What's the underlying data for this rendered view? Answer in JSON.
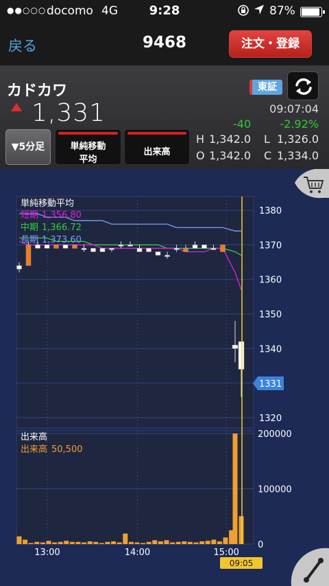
{
  "status": {
    "signal": "●●○○○",
    "carrier": "docomo",
    "network": "4G",
    "time": "9:28",
    "battery": "87%"
  },
  "nav": {
    "back": "戻る",
    "title": "9468",
    "order_button": "注文・登録"
  },
  "quote": {
    "name": "カドカワ",
    "exchange": "東証",
    "price": "1,331",
    "time": "09:07:04",
    "change": "-40",
    "change_pct": "-2.92%",
    "high_label": "H",
    "high": "1,342.0",
    "low_label": "L",
    "low": "1,326.0",
    "open_label": "O",
    "open": "1,342.0",
    "close_label": "C",
    "close": "1,334.0"
  },
  "buttons": {
    "period": "▼5分足",
    "ma_line1": "単純移動",
    "ma_line2": "平均",
    "volume": "出来高"
  },
  "colors": {
    "up": "#e52b2b",
    "down": "#35c738",
    "short_ma": "#e020e0",
    "mid_ma": "#30d040",
    "long_ma": "#7a9fff",
    "volume": "#f0a030",
    "bg": "#1d2a55"
  },
  "chart_data": {
    "type": "line",
    "price_panel": {
      "legend_title": "単純移動平均",
      "legend": [
        {
          "label": "短期",
          "value": "1,356.80",
          "color": "#e020e0"
        },
        {
          "label": "中期",
          "value": "1,366.72",
          "color": "#30d040"
        },
        {
          "label": "長期",
          "value": "1,373.60",
          "color": "#7a9fff"
        }
      ],
      "y_ticks": [
        "1380",
        "1370",
        "1360",
        "1350",
        "1340",
        "1330",
        "1320"
      ],
      "ylim": [
        1317,
        1384
      ],
      "current_price": "1331",
      "candles": [
        {
          "o": 1364,
          "h": 1365,
          "l": 1362,
          "c": 1363,
          "color": "white"
        },
        {
          "o": 1364,
          "h": 1371,
          "l": 1364,
          "c": 1370,
          "color": "orange"
        },
        {
          "o": 1370,
          "h": 1371,
          "l": 1369,
          "c": 1369,
          "color": "white"
        },
        {
          "o": 1370,
          "h": 1370,
          "l": 1369,
          "c": 1369,
          "color": "white"
        },
        {
          "o": 1369,
          "h": 1370,
          "l": 1369,
          "c": 1370,
          "color": "orange"
        },
        {
          "o": 1370,
          "h": 1370,
          "l": 1369,
          "c": 1369,
          "color": "white"
        },
        {
          "o": 1369,
          "h": 1370,
          "l": 1369,
          "c": 1370,
          "color": "orange"
        },
        {
          "o": 1369,
          "h": 1370,
          "l": 1368,
          "c": 1369,
          "color": "white"
        },
        {
          "o": 1369,
          "h": 1369,
          "l": 1368,
          "c": 1368,
          "color": "white"
        },
        {
          "o": 1369,
          "h": 1369,
          "l": 1368,
          "c": 1368,
          "color": "white"
        },
        {
          "o": 1369,
          "h": 1369,
          "l": 1368,
          "c": 1369,
          "color": "white"
        },
        {
          "o": 1370,
          "h": 1371,
          "l": 1369,
          "c": 1370,
          "color": "white"
        },
        {
          "o": 1370,
          "h": 1371,
          "l": 1370,
          "c": 1370,
          "color": "white"
        },
        {
          "o": 1369,
          "h": 1370,
          "l": 1368,
          "c": 1368,
          "color": "white"
        },
        {
          "o": 1368,
          "h": 1369,
          "l": 1368,
          "c": 1369,
          "color": "white"
        },
        {
          "o": 1368,
          "h": 1368,
          "l": 1367,
          "c": 1367,
          "color": "white"
        },
        {
          "o": 1367,
          "h": 1368,
          "l": 1366,
          "c": 1367,
          "color": "white"
        },
        {
          "o": 1369,
          "h": 1370,
          "l": 1368,
          "c": 1369,
          "color": "white"
        },
        {
          "o": 1369,
          "h": 1370,
          "l": 1368,
          "c": 1368,
          "color": "orange"
        },
        {
          "o": 1369,
          "h": 1371,
          "l": 1369,
          "c": 1370,
          "color": "white"
        },
        {
          "o": 1369,
          "h": 1370,
          "l": 1369,
          "c": 1370,
          "color": "white"
        },
        {
          "o": 1369,
          "h": 1370,
          "l": 1369,
          "c": 1369,
          "color": "white"
        },
        {
          "o": 1368,
          "h": 1370,
          "l": 1368,
          "c": 1370,
          "color": "orange"
        },
        {
          "o": 1340,
          "h": 1348,
          "l": 1336,
          "c": 1341,
          "color": "white"
        },
        {
          "o": 1342,
          "h": 1342,
          "l": 1326,
          "c": 1334,
          "color": "white"
        }
      ],
      "ma_short": [
        1371,
        1370,
        1370,
        1370,
        1370,
        1370,
        1370,
        1370,
        1370,
        1369,
        1369,
        1369,
        1369,
        1369,
        1369,
        1369,
        1369,
        1369,
        1368,
        1368,
        1368,
        1369,
        1369,
        1362,
        1357
      ],
      "ma_mid": [
        1372,
        1372,
        1372,
        1372,
        1371,
        1371,
        1371,
        1371,
        1370,
        1370,
        1370,
        1370,
        1370,
        1370,
        1370,
        1370,
        1369,
        1369,
        1369,
        1369,
        1369,
        1369,
        1369,
        1368,
        1367
      ],
      "ma_long": [
        1379,
        1379,
        1379,
        1378,
        1378,
        1378,
        1377,
        1377,
        1377,
        1377,
        1376,
        1376,
        1376,
        1376,
        1376,
        1376,
        1376,
        1375,
        1375,
        1375,
        1375,
        1375,
        1375,
        1374,
        1374
      ]
    },
    "volume_panel": {
      "legend_title": "出来高",
      "legend_label": "出来高",
      "legend_value": "50,500",
      "y_ticks": [
        "200000",
        "100000",
        "0"
      ],
      "ylim": [
        0,
        205000
      ],
      "values": [
        14000,
        8000,
        2000,
        4000,
        3000,
        6000,
        3000,
        4000,
        6000,
        4000,
        4000,
        3000,
        5000,
        4000,
        2000,
        4000,
        5000,
        3000,
        19000,
        4000,
        3000,
        2000,
        4000,
        7000,
        5000,
        7000,
        3000,
        4000,
        5000,
        4000,
        3000,
        5000,
        6000,
        8000,
        5000,
        12000,
        25000,
        200000,
        50500
      ]
    },
    "x_ticks": [
      "13:00",
      "14:00",
      "15:00"
    ],
    "cursor_label": "09:05"
  }
}
